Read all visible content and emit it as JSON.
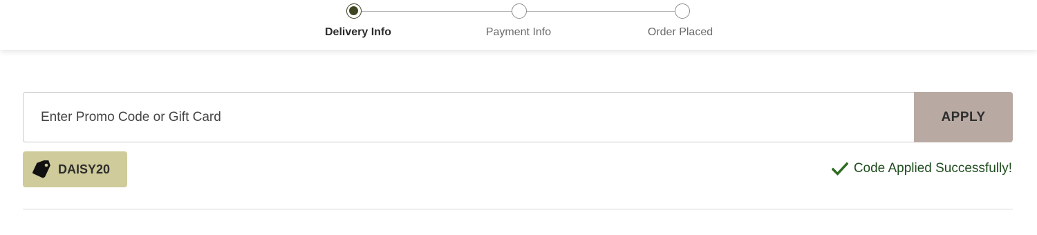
{
  "stepper": {
    "steps": [
      {
        "label": "Delivery Info",
        "state": "active"
      },
      {
        "label": "Payment Info",
        "state": "pending"
      },
      {
        "label": "Order Placed",
        "state": "pending"
      }
    ]
  },
  "promo": {
    "placeholder": "Enter Promo Code or Gift Card",
    "value": "",
    "apply_label": "APPLY"
  },
  "applied_code": {
    "code": "DAISY20",
    "icon": "tag-icon"
  },
  "status": {
    "message": "Code Applied Successfully!",
    "icon": "checkmark-icon"
  },
  "colors": {
    "accent_dark": "#3f4520",
    "apply_button": "#b8aaa3",
    "chip": "#cfcb9a",
    "success_text": "#1f4d1f",
    "success_icon": "#2e6b1f"
  }
}
